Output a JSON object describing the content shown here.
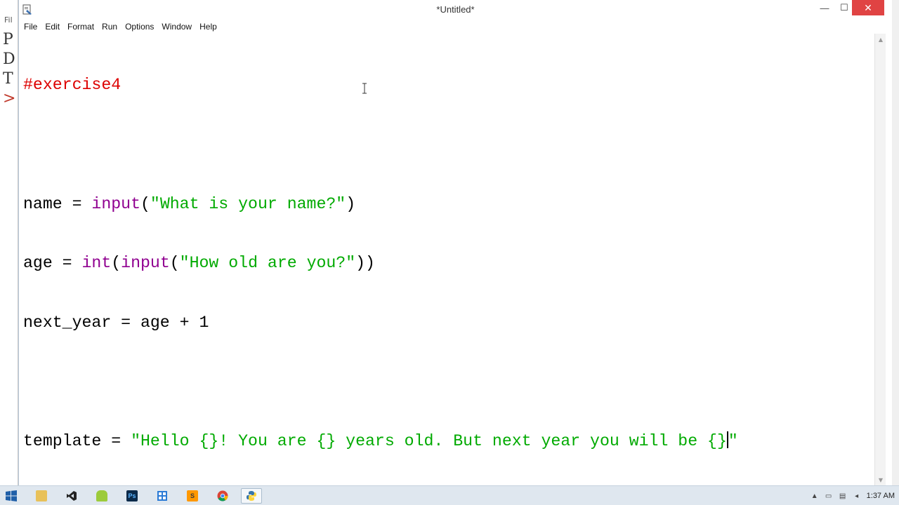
{
  "window": {
    "title": "*Untitled*",
    "minimize_glyph": "—",
    "maximize_glyph": "☐",
    "close_glyph": "✕"
  },
  "menu": {
    "items": [
      "File",
      "Edit",
      "Format",
      "Run",
      "Options",
      "Window",
      "Help"
    ]
  },
  "background_shell": {
    "menu_fragment": "Fil",
    "line_chars": [
      "P",
      "D",
      "T",
      ">"
    ]
  },
  "code": {
    "line1_comment": "#exercise4",
    "line3_a": "name = ",
    "line3_builtin": "input",
    "line3_b": "(",
    "line3_string": "\"What is your name?\"",
    "line3_c": ")",
    "line4_a": "age = ",
    "line4_builtin1": "int",
    "line4_b": "(",
    "line4_builtin2": "input",
    "line4_c": "(",
    "line4_string": "\"How old are you?\"",
    "line4_d": "))",
    "line5": "next_year = age + 1",
    "line7_a": "template = ",
    "line7_string_before_cursor": "\"Hello {}! You are {} years old. But next year you will be {}",
    "line7_string_after_cursor": "\""
  },
  "colors": {
    "comment": "#dd0000",
    "builtin": "#900090",
    "string": "#00aa00",
    "close_button": "#e04343",
    "taskbar": "#dfe7ef"
  },
  "taskbar": {
    "icons": [
      "file-explorer-icon",
      "visual-studio-icon",
      "android-icon",
      "photoshop-icon",
      "calculator-icon",
      "sublime-text-icon",
      "chrome-icon",
      "python-idle-icon"
    ],
    "active_icon": "python-idle-icon",
    "photoshop_label": "Ps",
    "clock": "1:37 AM",
    "tray_up_glyph": "▲"
  }
}
